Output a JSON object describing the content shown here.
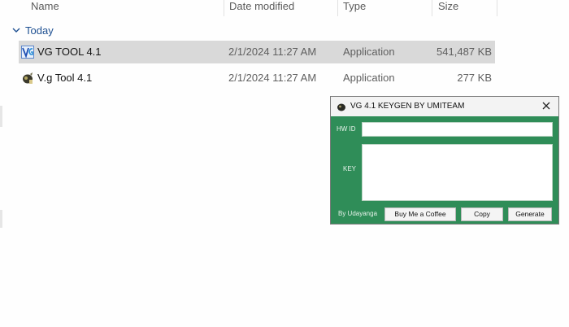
{
  "columns": {
    "name": "Name",
    "date_modified": "Date modified",
    "type": "Type",
    "size": "Size"
  },
  "group": {
    "label": "Today",
    "icon": "chevron-down-icon"
  },
  "files": [
    {
      "name": "VG TOOL 4.1",
      "date": "2/1/2024 11:27 AM",
      "type": "Application",
      "size": "541,487 KB",
      "icon": "vg-app-icon",
      "selected": true
    },
    {
      "name": "V.g Tool 4.1",
      "date": "2/1/2024 11:27 AM",
      "type": "Application",
      "size": "277 KB",
      "icon": "keygen-app-icon",
      "selected": false
    }
  ],
  "keygen": {
    "title": "VG 4.1 KEYGEN BY UMITEAM",
    "hwid_label": "HW ID",
    "hwid_value": "",
    "key_label": "KEY",
    "key_value": "",
    "by_label": "By Udayanga",
    "buttons": {
      "coffee": "Buy Me a Coffee",
      "copy": "Copy",
      "generate": "Generate"
    },
    "colors": {
      "background": "#2f8d58",
      "titlebar": "#f3f3f3"
    }
  },
  "colors": {
    "selection": "#d9d9d9",
    "group_header": "#1d4f91"
  }
}
